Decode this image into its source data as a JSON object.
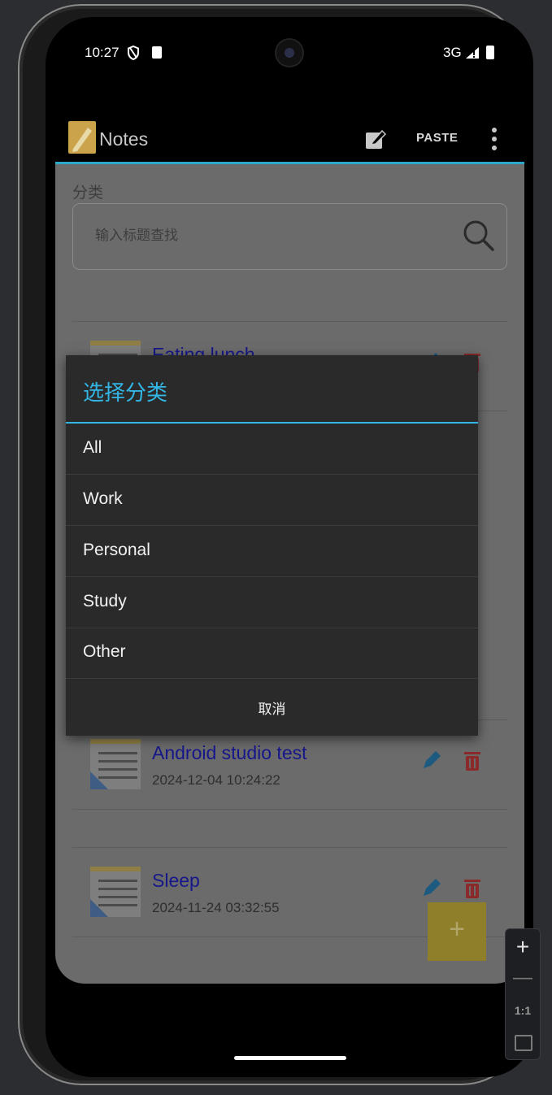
{
  "status": {
    "time": "10:27",
    "network": "3G"
  },
  "appbar": {
    "title": "Notes",
    "paste_label": "PASTE"
  },
  "filter": {
    "category_label": "分类",
    "search_placeholder": "输入标题查找"
  },
  "notes": [
    {
      "title": "Eating lunch",
      "date": ""
    },
    {
      "title": "Android studio test",
      "date": "2024-12-04 10:24:22"
    },
    {
      "title": "Sleep",
      "date": "2024-11-24 03:32:55"
    }
  ],
  "fab": {
    "label": "+"
  },
  "dialog": {
    "title": "选择分类",
    "options": [
      "All",
      "Work",
      "Personal",
      "Study",
      "Other"
    ],
    "cancel": "取消"
  },
  "emulator": {
    "zoom_in": "+",
    "zoom_out": "—",
    "actual_size": "1:1"
  },
  "colors": {
    "accent": "#33b5e5",
    "note_title": "#16178a",
    "delete": "#c62828",
    "fab": "#d4bb3c"
  }
}
